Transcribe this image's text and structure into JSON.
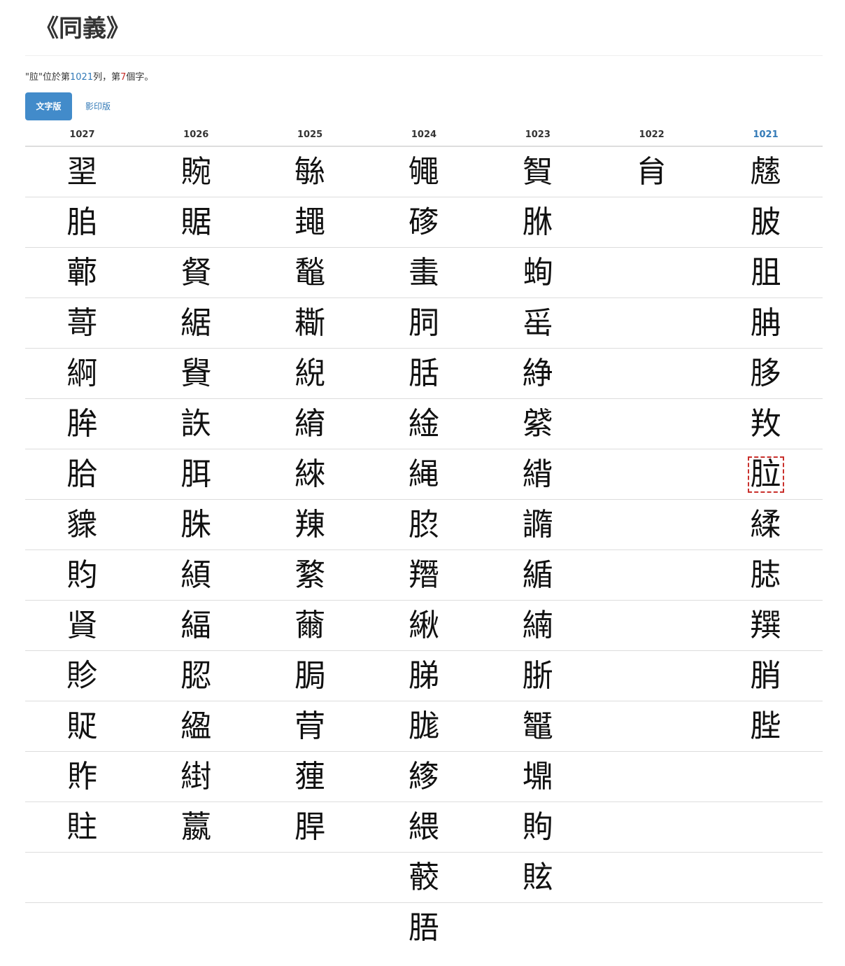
{
  "page": {
    "title": "《同義》"
  },
  "info": {
    "quote_open": "\"",
    "glyph": "䏠",
    "quote_close": "\"",
    "text_before_col": "位於第",
    "column": "1021",
    "text_before_pos": "列，第",
    "position": "7",
    "text_after": "個字。"
  },
  "tabs": [
    {
      "label": "文字版",
      "active": true
    },
    {
      "label": "影印版",
      "active": false
    }
  ],
  "colors": {
    "accent": "#428bca",
    "link": "#337ab7",
    "highlight": "#c9302c"
  },
  "table": {
    "columns": [
      "1027",
      "1026",
      "1025",
      "1024",
      "1023",
      "1022",
      "1021"
    ],
    "current_column": "1021",
    "highlight": {
      "row": 6,
      "col": 6
    },
    "rows": [
      [
        "䍿",
        "䝹",
        "䋣",
        "䵶",
        "䝷",
        "䏍",
        "䖛"
      ],
      [
        "䏨",
        "䝻",
        "䵷",
        "䃎",
        "䏫",
        "",
        "䏢"
      ],
      [
        "䕤",
        "䝳",
        "䵸",
        "䖯",
        "䖲",
        "",
        "䏣"
      ],
      [
        "䔅",
        "䋧",
        "䎰",
        "䏤",
        "䍃",
        "",
        "䏥"
      ],
      [
        "䋪",
        "䝿",
        "䋩",
        "䏦",
        "䋫",
        "",
        "䏧"
      ],
      [
        "䏬",
        "䛈",
        "䋭",
        "䋮",
        "䋯",
        "",
        "䍩"
      ],
      [
        "䏩",
        "䏪",
        "䋱",
        "䋲",
        "䋳",
        "",
        "䏠"
      ],
      [
        "䝦",
        "䏭",
        "䍶",
        "䏮",
        "䜏",
        "",
        "䋴"
      ],
      [
        "䝧",
        "䋶",
        "䋷",
        "䍼",
        "䋸",
        "",
        "䏯"
      ],
      [
        "䝨",
        "䋹",
        "䕥",
        "䋺",
        "䋻",
        "",
        "䍻"
      ],
      [
        "䝩",
        "䏰",
        "䏱",
        "䏲",
        "䏳",
        "",
        "䏴"
      ],
      [
        "䝪",
        "䋼",
        "䒿",
        "䏵",
        "䵹",
        "",
        "䏶"
      ],
      [
        "䝫",
        "䋽",
        "䔆",
        "䋾",
        "䵺",
        "",
        ""
      ],
      [
        "䝬",
        "䕦",
        "䏷",
        "䋿",
        "䝭",
        "",
        ""
      ],
      [
        "",
        "",
        "",
        "䕧",
        "䝮",
        "",
        ""
      ],
      [
        "",
        "",
        "",
        "䏸",
        "",
        "",
        ""
      ]
    ]
  }
}
